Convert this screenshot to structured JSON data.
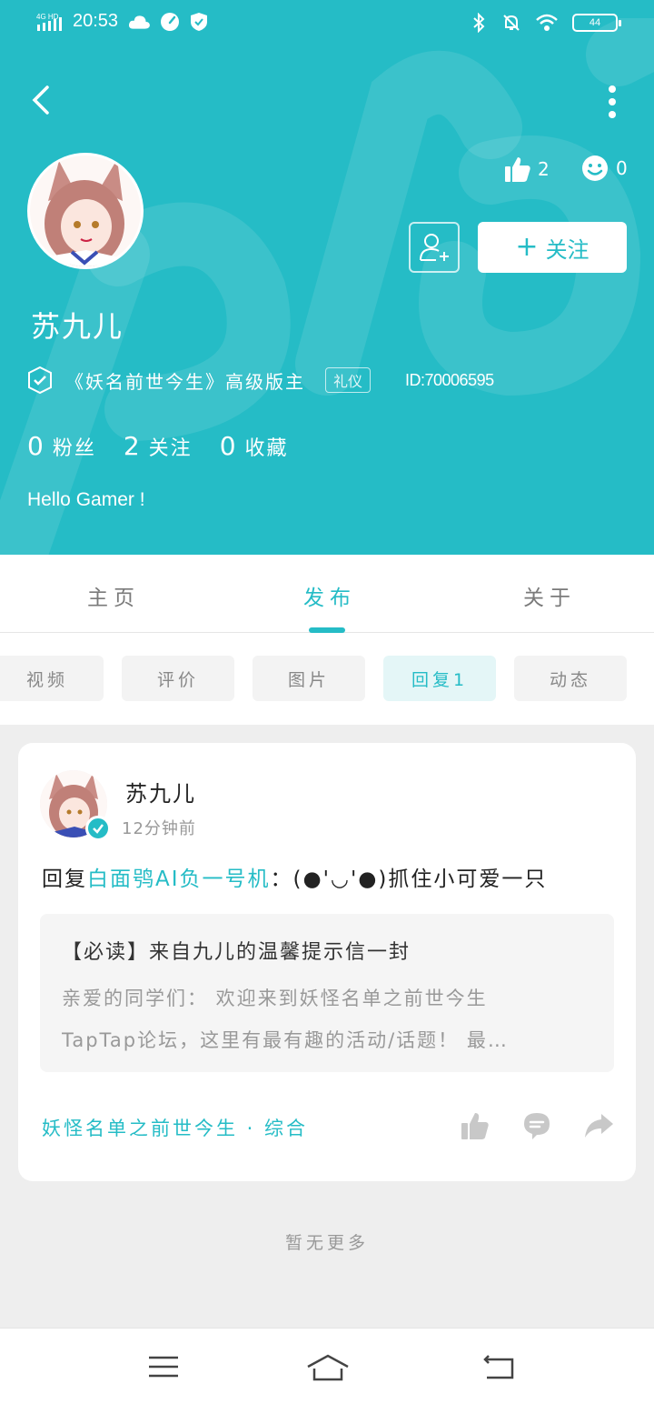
{
  "status_bar": {
    "network": "4G HD",
    "time": "20:53",
    "battery": "44"
  },
  "profile": {
    "username": "苏九儿",
    "role": "《妖名前世今生》高级版主",
    "badge": "礼仪",
    "id": "ID:70006595",
    "likes": "2",
    "reactions": "0",
    "follow_label": "关注",
    "counts": [
      {
        "num": "0",
        "label": "粉丝"
      },
      {
        "num": "2",
        "label": "关注"
      },
      {
        "num": "0",
        "label": "收藏"
      }
    ],
    "bio": "Hello Gamer !"
  },
  "tabs": [
    "主页",
    "发布",
    "关于"
  ],
  "active_tab": "发布",
  "subtabs": [
    "视频",
    "评价",
    "图片",
    "回复1",
    "动态"
  ],
  "active_subtab": "回复1",
  "post": {
    "author": "苏九儿",
    "time": "12分钟前",
    "reply_prefix": "回复",
    "reply_to": "白面鸮AI负一号机",
    "reply_text": "：(●'◡'●)抓住小可爱一只",
    "quote_title": "【必读】来自九儿的温馨提示信一封",
    "quote_line1": "亲爱的同学们：  欢迎来到妖怪名单之前世今生",
    "quote_line2": "TapTap论坛，这里有最有趣的活动/话题！ 最…",
    "forum": "妖怪名单之前世今生 · 综合"
  },
  "no_more": "暂无更多",
  "colors": {
    "brand": "#25bcc6",
    "background": "#eeeeee"
  }
}
